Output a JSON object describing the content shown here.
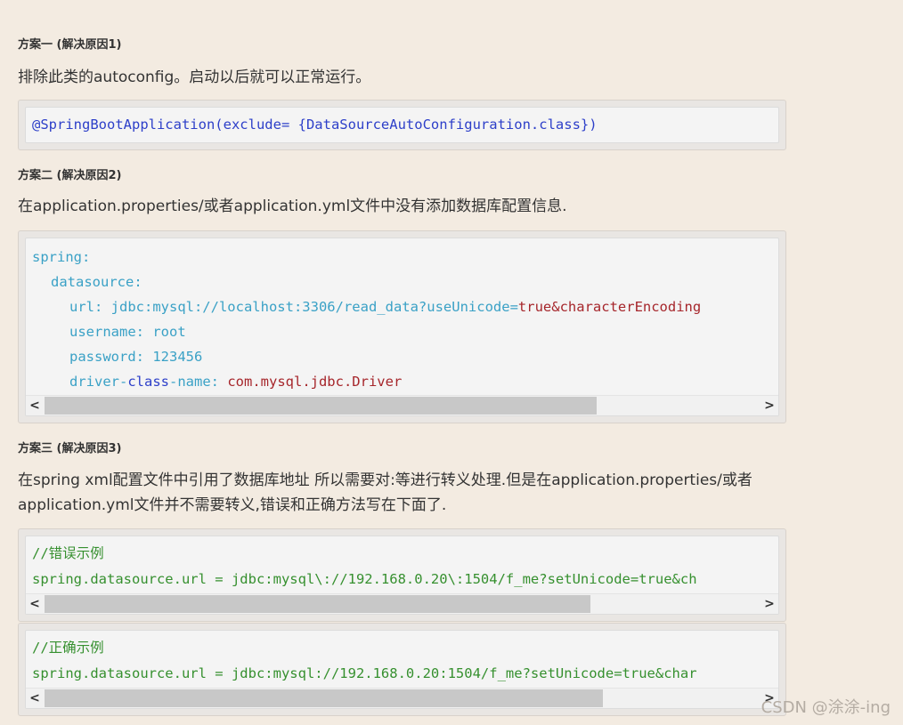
{
  "solution1": {
    "heading": "方案一 (解决原因1)",
    "description": "排除此类的autoconfig。启动以后就可以正常运行。",
    "code": "@SpringBootApplication(exclude= {DataSourceAutoConfiguration.class})"
  },
  "solution2": {
    "heading": "方案二 (解决原因2)",
    "description": "在application.properties/或者application.yml文件中没有添加数据库配置信息.",
    "code": {
      "line1": "spring:",
      "line2": "datasource:",
      "line3_key": "url: jdbc:mysql://localhost:3306/read_data?useUnicode=",
      "line3_val": "true&characterEncoding",
      "line4": "username: root",
      "line5": "password: 123456",
      "line6_a": "driver-",
      "line6_b": "class",
      "line6_c": "-name: ",
      "line6_d": "com.mysql.jdbc.Driver"
    }
  },
  "solution3": {
    "heading": "方案三 (解决原因3)",
    "description_line1": "在spring xml配置文件中引用了数据库地址 所以需要对:等进行转义处理.但是在application.properties/或者",
    "description_line2": "application.yml文件并不需要转义,错误和正确方法写在下面了.",
    "wrong": {
      "comment": "//错误示例",
      "code": "spring.datasource.url = jdbc:mysql\\://192.168.0.20\\:1504/f_me?setUnicode=true&ch"
    },
    "right": {
      "comment": "//正确示例",
      "code": "spring.datasource.url = jdbc:mysql://192.168.0.20:1504/f_me?setUnicode=true&char"
    }
  },
  "scroll": {
    "left_arrow": "<",
    "right_arrow": ">"
  },
  "watermark": "CSDN @涂涂-ing",
  "colors": {
    "background": "#f3ebe1",
    "code_blue": "#2d3fc9",
    "code_cyan": "#3aa1c6",
    "code_red": "#a6262b",
    "code_green": "#36902f"
  }
}
